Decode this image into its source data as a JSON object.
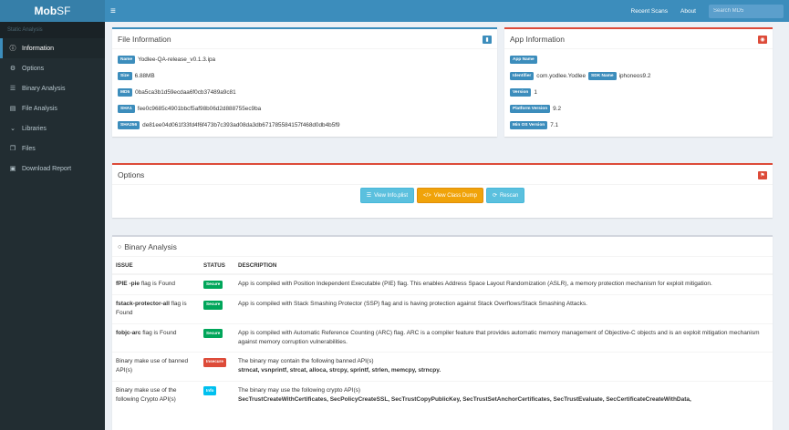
{
  "app": {
    "brand_mob": "Mob",
    "brand_sf": "SF"
  },
  "sidebar": {
    "header": "Static Analysis",
    "items": [
      {
        "label": "Information",
        "icon": "info-circle-icon",
        "glyph": "ⓘ",
        "active": true
      },
      {
        "label": "Options",
        "icon": "cogs-icon",
        "glyph": "⚙",
        "active": false
      },
      {
        "label": "Binary Analysis",
        "icon": "binary-icon",
        "glyph": "☰",
        "active": false
      },
      {
        "label": "File Analysis",
        "icon": "file-icon",
        "glyph": "▤",
        "active": false
      },
      {
        "label": "Libraries",
        "icon": "chevron-down-icon",
        "glyph": "⌄",
        "active": false
      },
      {
        "label": "Files",
        "icon": "files-icon",
        "glyph": "❐",
        "active": false
      },
      {
        "label": "Download Report",
        "icon": "download-icon",
        "glyph": "▣",
        "active": false
      }
    ]
  },
  "topbar": {
    "menu_glyph": "≡",
    "recent_scans": "Recent Scans",
    "about": "About",
    "search_placeholder": "Search MD5"
  },
  "file_info": {
    "title": "File Information",
    "rows": [
      {
        "label": "Name",
        "value": "Yodlee-QA-release_v0.1.3.ipa"
      },
      {
        "label": "Size",
        "value": "6.88MB"
      },
      {
        "label": "MD5",
        "value": "0ba5ca3b1d59ecdaa6f0cb37489a9c81"
      },
      {
        "label": "SHA1",
        "value": "fee0c9685c4901bbcf5af98b06d2d888755ec9ba"
      },
      {
        "label": "SHA256",
        "value": "de81ee04d061f33fd4f6f473b7c393ad08da3db671785584157f468d0db4b5f9"
      }
    ]
  },
  "app_info": {
    "title": "App Information",
    "app_name_label": "App Name",
    "identifier_label": "Identifier",
    "identifier_value": "com.yodlee.Yodlee",
    "sdk_label": "SDK Name",
    "sdk_value": "iphoneos9.2",
    "version_label": "Version",
    "version_value": "1",
    "platform_label": "Platform Version",
    "platform_value": "9.2",
    "minos_label": "Min OS Version",
    "minos_value": "7.1"
  },
  "options": {
    "title": "Options",
    "btn_info_plist": "View Info.plist",
    "btn_class_dump": "View Class Dump",
    "btn_rescan": "Rescan"
  },
  "binary": {
    "title": "Binary Analysis",
    "col_issue": "ISSUE",
    "col_status": "STATUS",
    "col_desc": "DESCRIPTION",
    "rows": [
      {
        "issue_bold": "fPIE -pie",
        "issue_rest": " flag is Found",
        "status": "Secure",
        "desc": "App is compiled with Position Independent Executable (PIE) flag. This enables Address Space Layout Randomization (ASLR), a memory protection mechanism for exploit mitigation.",
        "desc2": ""
      },
      {
        "issue_bold": "fstack-protector-all",
        "issue_rest": " flag is Found",
        "status": "Secure",
        "desc": "App is compiled with Stack Smashing Protector (SSP) flag and is having protection against Stack Overflows/Stack Smashing Attacks.",
        "desc2": ""
      },
      {
        "issue_bold": "fobjc-arc",
        "issue_rest": " flag is Found",
        "status": "Secure",
        "desc": "App is compiled with Automatic Reference Counting (ARC) flag. ARC is a compiler feature that provides automatic memory management of Objective-C objects and is an exploit mitigation mechanism against memory corruption vulnerabilities.",
        "desc2": ""
      },
      {
        "issue_bold": "",
        "issue_rest": "Binary make use of banned API(s)",
        "status": "Insecure",
        "desc": "The binary may contain the following banned API(s)",
        "desc2": "strncat, vsnprintf, strcat, alloca, strcpy, sprintf, strlen, memcpy, strncpy."
      },
      {
        "issue_bold": "",
        "issue_rest": "Binary make use of the following Crypto API(s)",
        "status": "Info",
        "desc": "The binary may use the following crypto API(s)",
        "desc2": "SecTrustCreateWithCertificates, SecPolicyCreateSSL, SecTrustCopyPublicKey, SecTrustSetAnchorCertificates, SecTrustEvaluate, SecCertificateCreateWithData,"
      }
    ]
  },
  "colors": {
    "topbar": "#3c8dbc",
    "sidebar": "#222d32",
    "secure": "#00a65a",
    "insecure": "#dd4b39",
    "info": "#00c0ef"
  }
}
